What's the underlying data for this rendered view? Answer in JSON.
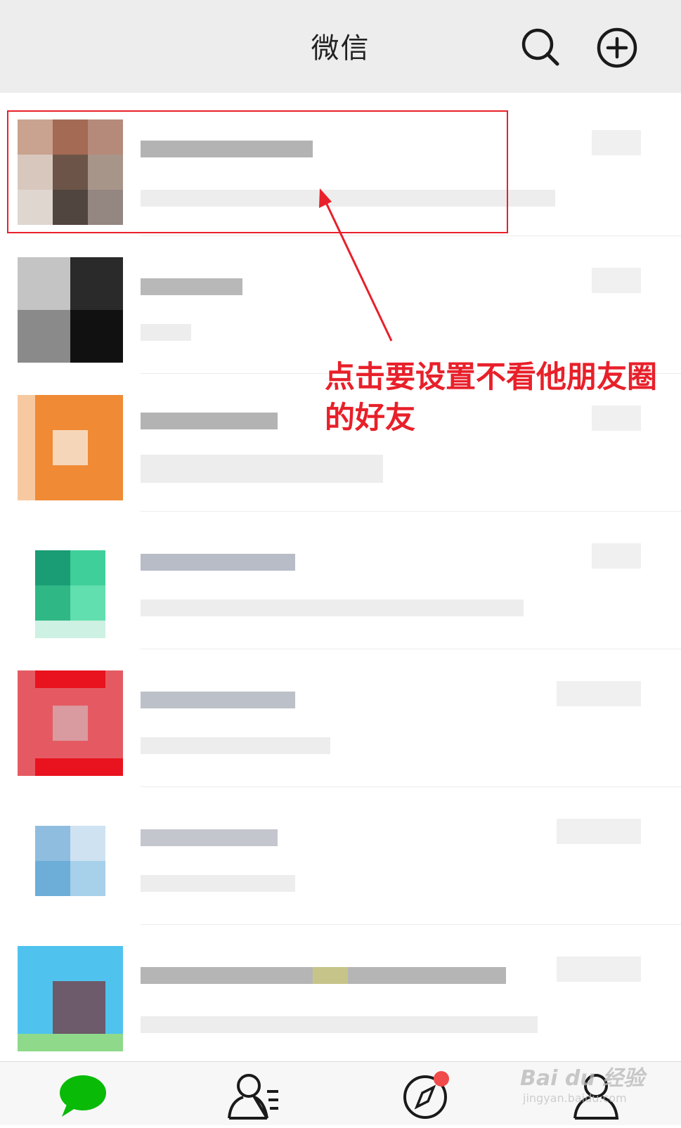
{
  "header": {
    "title": "微信",
    "search_icon": "search-icon",
    "add_icon": "plus-circle-icon"
  },
  "chats": [
    {
      "avatar": "blurred-avatar",
      "name": "",
      "preview": "",
      "time": ""
    },
    {
      "avatar": "blurred-avatar",
      "name": "",
      "preview": "",
      "time": ""
    },
    {
      "avatar": "blurred-avatar",
      "name": "",
      "preview": "",
      "time": ""
    },
    {
      "avatar": "blurred-avatar",
      "name": "",
      "preview": "",
      "time": ""
    },
    {
      "avatar": "blurred-avatar",
      "name": "",
      "preview": "",
      "time": ""
    },
    {
      "avatar": "blurred-avatar",
      "name": "",
      "preview": "",
      "time": ""
    },
    {
      "avatar": "blurred-avatar",
      "name": "",
      "preview": "",
      "time": ""
    }
  ],
  "annotation": {
    "text": "点击要设置不看他朋友圈的好友",
    "color": "#e8202a"
  },
  "tabbar": {
    "tabs": [
      {
        "icon": "chat-bubble-icon",
        "active": true
      },
      {
        "icon": "contacts-icon",
        "active": false
      },
      {
        "icon": "compass-icon",
        "active": false,
        "badge": true
      },
      {
        "icon": "me-person-icon",
        "active": false
      }
    ],
    "accent": "#09bb07",
    "badge_color": "#f04a4a"
  },
  "watermark": {
    "brand": "Bai du 经验",
    "url": "jingyan.baidu.com"
  }
}
